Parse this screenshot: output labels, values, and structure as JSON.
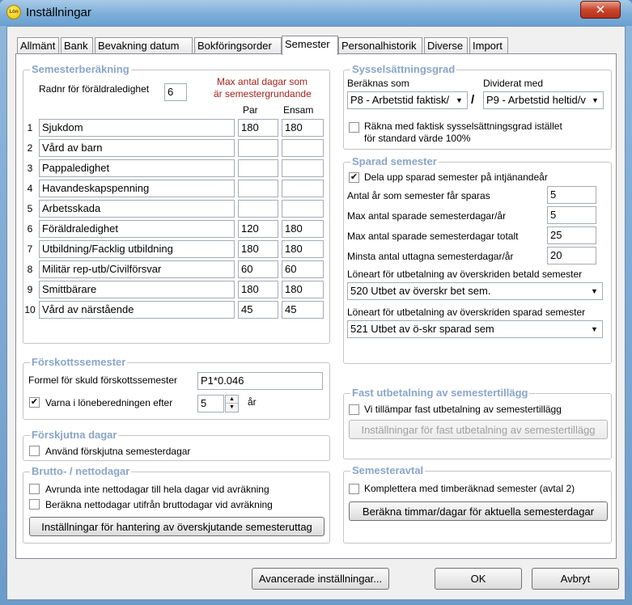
{
  "window": {
    "title": "Inställningar",
    "icon_label": "Lön",
    "close_glyph": "✕"
  },
  "tabs": [
    {
      "label": "Allmänt",
      "active": false
    },
    {
      "label": "Bank",
      "active": false
    },
    {
      "label": "Bevakning datum",
      "active": false
    },
    {
      "label": "Bokföringsorder",
      "active": false
    },
    {
      "label": "Semester",
      "active": true
    },
    {
      "label": "Personalhistorik",
      "active": false
    },
    {
      "label": "Diverse",
      "active": false
    },
    {
      "label": "Import",
      "active": false
    }
  ],
  "semesterberakning": {
    "title": "Semesterberäkning",
    "radnr_label": "Radnr för föräldraledighet",
    "radnr_value": "6",
    "max_label_1": "Max antal dagar som",
    "max_label_2": "är semestergrundande",
    "col_par": "Par",
    "col_ensam": "Ensam",
    "rows": [
      {
        "nr": "1",
        "name": "Sjukdom",
        "par": "180",
        "ensam": "180"
      },
      {
        "nr": "2",
        "name": "Vård av barn",
        "par": "",
        "ensam": ""
      },
      {
        "nr": "3",
        "name": "Pappaledighet",
        "par": "",
        "ensam": ""
      },
      {
        "nr": "4",
        "name": "Havandeskapspenning",
        "par": "",
        "ensam": ""
      },
      {
        "nr": "5",
        "name": "Arbetsskada",
        "par": "",
        "ensam": ""
      },
      {
        "nr": "6",
        "name": "Föräldraledighet",
        "par": "120",
        "ensam": "180"
      },
      {
        "nr": "7",
        "name": "Utbildning/Facklig utbildning",
        "par": "180",
        "ensam": "180"
      },
      {
        "nr": "8",
        "name": "Militär rep-utb/Civilförsvar",
        "par": "60",
        "ensam": "60"
      },
      {
        "nr": "9",
        "name": "Smittbärare",
        "par": "180",
        "ensam": "180"
      },
      {
        "nr": "10",
        "name": "Vård av närstående",
        "par": "45",
        "ensam": "45"
      }
    ]
  },
  "forskottssemester": {
    "title": "Förskottssemester",
    "formel_label": "Formel för skuld förskottssemester",
    "formel_value": "P1*0.046",
    "varna_label": "Varna i löneberedningen efter",
    "varna_checked": "✔",
    "varna_value": "5",
    "varna_unit": "år"
  },
  "forskjutna": {
    "title": "Förskjutna dagar",
    "check_label": "Använd förskjutna semesterdagar"
  },
  "brutto": {
    "title": "Brutto- / nettodagar",
    "check1_label": "Avrunda inte nettodagar till hela dagar vid avräkning",
    "check2_label": "Beräkna nettodagar utifrån bruttodagar vid avräkning",
    "button_label": "Inställningar för hantering av överskjutande semesteruttag"
  },
  "syssel": {
    "title": "Sysselsättningsgrad",
    "beraknas_label": "Beräknas som",
    "beraknas_value": "P8 - Arbetstid faktisk/",
    "slash": "/",
    "dividerat_label": "Dividerat med",
    "dividerat_value": "P9 - Arbetstid heltid/v",
    "check_line1": "Räkna med faktisk sysselsättningsgrad istället",
    "check_line2": "för standard värde 100%"
  },
  "sparad": {
    "title": "Sparad semester",
    "dela_label": "Dela upp sparad semester på intjänandeår",
    "dela_checked": "✔",
    "fields": [
      {
        "label": "Antal år som semester får sparas",
        "value": "5"
      },
      {
        "label": "Max antal sparade semesterdagar/år",
        "value": "5"
      },
      {
        "label": "Max antal sparade semesterdagar totalt",
        "value": "25"
      },
      {
        "label": "Minsta antal uttagna semesterdagar/år",
        "value": "20"
      }
    ],
    "loneart1_label": "Löneart för utbetalning av överskriden betald semester",
    "loneart1_value": "520 Utbet av överskr bet sem.",
    "loneart2_label": "Löneart för utbetalning av överskriden sparad semester",
    "loneart2_value": "521 Utbet av ö-skr sparad sem"
  },
  "fast": {
    "title": "Fast utbetalning av semestertillägg",
    "check_label": "Vi tillämpar fast utbetalning av semestertillägg",
    "button_label": "Inställningar för fast utbetalning av semestertillägg"
  },
  "avtal": {
    "title": "Semesteravtal",
    "check_label": "Komplettera med timberäknad semester (avtal 2)",
    "button_label": "Beräkna timmar/dagar för aktuella semesterdagar"
  },
  "footer": {
    "advanced_label": "Avancerade inställningar...",
    "ok_label": "OK",
    "cancel_label": "Avbryt"
  },
  "icons": {
    "dropdown": "▼",
    "spin_up": "▲",
    "spin_down": "▼"
  }
}
